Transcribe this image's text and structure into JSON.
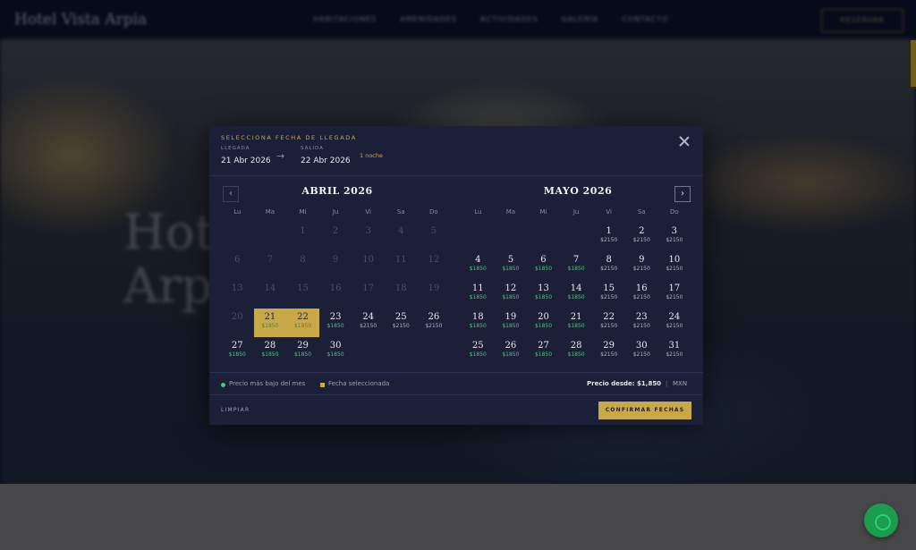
{
  "site": {
    "brand": "Hotel Vista Arpia",
    "nav": [
      "HABITACIONES",
      "AMENIDADES",
      "ACTIVIDADES",
      "GALERÍA",
      "CONTACTO"
    ],
    "book": "RESERVAR",
    "hero_title_line1": "Hot",
    "hero_title_line2": "Arp"
  },
  "modal": {
    "title": "SELECCIONA FECHA DE LLEGADA",
    "arrival_label": "LLEGADA",
    "arrival_value": "21 Abr 2026",
    "departure_label": "SALIDA",
    "departure_value": "22 Abr 2026",
    "arrow": "→",
    "nights": "1 noche",
    "close_icon": "close-icon",
    "months": [
      {
        "title": "ABRIL 2026",
        "nav": "‹",
        "weekdays": [
          "Lu",
          "Ma",
          "Mi",
          "Ju",
          "Vi",
          "Sa",
          "Do"
        ],
        "days": [
          {
            "n": "",
            "p": "",
            "s": "empty"
          },
          {
            "n": "",
            "p": "",
            "s": "empty"
          },
          {
            "n": "1",
            "p": "",
            "s": "past"
          },
          {
            "n": "2",
            "p": "",
            "s": "past"
          },
          {
            "n": "3",
            "p": "",
            "s": "past"
          },
          {
            "n": "4",
            "p": "",
            "s": "past"
          },
          {
            "n": "5",
            "p": "",
            "s": "past"
          },
          {
            "n": "6",
            "p": "",
            "s": "past"
          },
          {
            "n": "7",
            "p": "",
            "s": "past"
          },
          {
            "n": "8",
            "p": "",
            "s": "past"
          },
          {
            "n": "9",
            "p": "",
            "s": "past"
          },
          {
            "n": "10",
            "p": "",
            "s": "past"
          },
          {
            "n": "11",
            "p": "",
            "s": "past"
          },
          {
            "n": "12",
            "p": "",
            "s": "past"
          },
          {
            "n": "13",
            "p": "",
            "s": "past"
          },
          {
            "n": "14",
            "p": "",
            "s": "past"
          },
          {
            "n": "15",
            "p": "",
            "s": "past"
          },
          {
            "n": "16",
            "p": "",
            "s": "past"
          },
          {
            "n": "17",
            "p": "",
            "s": "past"
          },
          {
            "n": "18",
            "p": "",
            "s": "past"
          },
          {
            "n": "19",
            "p": "",
            "s": "past"
          },
          {
            "n": "20",
            "p": "",
            "s": "past"
          },
          {
            "n": "21",
            "p": "$1850",
            "s": "sel"
          },
          {
            "n": "22",
            "p": "$1850",
            "s": "sel"
          },
          {
            "n": "23",
            "p": "$1850",
            "s": "low"
          },
          {
            "n": "24",
            "p": "$2150",
            "s": "std"
          },
          {
            "n": "25",
            "p": "$2150",
            "s": "std"
          },
          {
            "n": "26",
            "p": "$2150",
            "s": "std"
          },
          {
            "n": "27",
            "p": "$1850",
            "s": "low"
          },
          {
            "n": "28",
            "p": "$1850",
            "s": "low"
          },
          {
            "n": "29",
            "p": "$1850",
            "s": "low"
          },
          {
            "n": "30",
            "p": "$1850",
            "s": "low"
          }
        ]
      },
      {
        "title": "MAYO 2026",
        "nav": "›",
        "weekdays": [
          "Lu",
          "Ma",
          "Mi",
          "Ju",
          "Vi",
          "Sa",
          "Do"
        ],
        "days": [
          {
            "n": "",
            "p": "",
            "s": "empty"
          },
          {
            "n": "",
            "p": "",
            "s": "empty"
          },
          {
            "n": "",
            "p": "",
            "s": "empty"
          },
          {
            "n": "",
            "p": "",
            "s": "empty"
          },
          {
            "n": "1",
            "p": "$2150",
            "s": "std"
          },
          {
            "n": "2",
            "p": "$2150",
            "s": "std"
          },
          {
            "n": "3",
            "p": "$2150",
            "s": "std"
          },
          {
            "n": "4",
            "p": "$1850",
            "s": "low"
          },
          {
            "n": "5",
            "p": "$1850",
            "s": "low"
          },
          {
            "n": "6",
            "p": "$1850",
            "s": "low"
          },
          {
            "n": "7",
            "p": "$1850",
            "s": "low"
          },
          {
            "n": "8",
            "p": "$2150",
            "s": "std"
          },
          {
            "n": "9",
            "p": "$2150",
            "s": "std"
          },
          {
            "n": "10",
            "p": "$2150",
            "s": "std"
          },
          {
            "n": "11",
            "p": "$1850",
            "s": "low"
          },
          {
            "n": "12",
            "p": "$1850",
            "s": "low"
          },
          {
            "n": "13",
            "p": "$1850",
            "s": "low"
          },
          {
            "n": "14",
            "p": "$1850",
            "s": "low"
          },
          {
            "n": "15",
            "p": "$2150",
            "s": "std"
          },
          {
            "n": "16",
            "p": "$2150",
            "s": "std"
          },
          {
            "n": "17",
            "p": "$2150",
            "s": "std"
          },
          {
            "n": "18",
            "p": "$1850",
            "s": "low"
          },
          {
            "n": "19",
            "p": "$1850",
            "s": "low"
          },
          {
            "n": "20",
            "p": "$1850",
            "s": "low"
          },
          {
            "n": "21",
            "p": "$1850",
            "s": "low"
          },
          {
            "n": "22",
            "p": "$2150",
            "s": "std"
          },
          {
            "n": "23",
            "p": "$2150",
            "s": "std"
          },
          {
            "n": "24",
            "p": "$2150",
            "s": "std"
          },
          {
            "n": "25",
            "p": "$1850",
            "s": "low"
          },
          {
            "n": "26",
            "p": "$1850",
            "s": "low"
          },
          {
            "n": "27",
            "p": "$1850",
            "s": "low"
          },
          {
            "n": "28",
            "p": "$1850",
            "s": "low"
          },
          {
            "n": "29",
            "p": "$2150",
            "s": "std"
          },
          {
            "n": "30",
            "p": "$2150",
            "s": "std"
          },
          {
            "n": "31",
            "p": "$2150",
            "s": "std"
          }
        ]
      }
    ],
    "legend_low": "Precio más bajo del mes",
    "legend_selected": "Fecha seleccionada",
    "price_from": "Precio desde: $1,850",
    "separator": "|",
    "currency": "MXN",
    "clear": "LIMPIAR",
    "confirm": "CONFIRMAR FECHAS",
    "colors": {
      "accent": "#c9a84a",
      "low_price": "#49c77a",
      "panel": "#1c1f38"
    }
  }
}
